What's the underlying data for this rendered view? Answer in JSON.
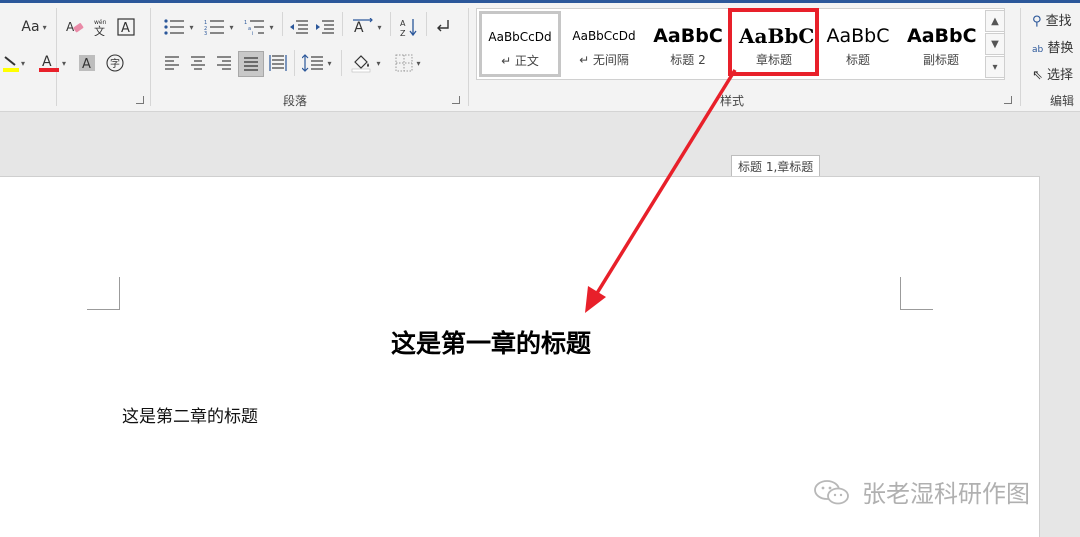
{
  "font_group": {
    "change_case": "Aa",
    "clear_format_icon": "eraser-icon",
    "phonetic_icon": "phonetic-guide-icon",
    "char_border_icon": "character-border-icon",
    "highlight_icon": "highlighter-icon",
    "font_color_icon": "font-color-icon",
    "font_color": "#e8202a",
    "shading_icon": "character-shading-icon",
    "enclose_icon": "enclose-character-icon"
  },
  "paragraph_group": {
    "label": "段落",
    "bullets_icon": "bullets-icon",
    "numbering_icon": "numbering-icon",
    "multilevel_icon": "multilevel-list-icon",
    "decrease_indent_icon": "decrease-indent-icon",
    "increase_indent_icon": "increase-indent-icon",
    "cjk_layout_icon": "asian-layout-icon",
    "sort_icon": "sort-icon",
    "show_marks_icon": "paragraph-mark-icon",
    "align_left_icon": "align-left-icon",
    "align_center_icon": "align-center-icon",
    "align_right_icon": "align-right-icon",
    "justify_icon": "justify-icon",
    "distributed_icon": "distributed-icon",
    "line_spacing_icon": "line-spacing-icon",
    "shading_icon": "paint-bucket-icon",
    "borders_icon": "borders-icon"
  },
  "styles_group": {
    "label": "样式",
    "items": [
      {
        "sample": "AaBbCcDd",
        "name": "↵ 正文"
      },
      {
        "sample": "AaBbCcDd",
        "name": "↵ 无间隔"
      },
      {
        "sample": "AaBbC",
        "name": "标题 2"
      },
      {
        "sample": "AaBbC",
        "name": "章标题"
      },
      {
        "sample": "AaBbC",
        "name": "标题"
      },
      {
        "sample": "AaBbC",
        "name": "副标题"
      }
    ],
    "highlight_color": "#e8202a"
  },
  "editing_group": {
    "label": "编辑",
    "find": "查找",
    "replace": "替换",
    "select": "选择"
  },
  "tooltip": "标题 1,章标题",
  "document": {
    "heading": "这是第一章的标题",
    "paragraph": "这是第二章的标题"
  },
  "watermark": "张老湿科研作图"
}
